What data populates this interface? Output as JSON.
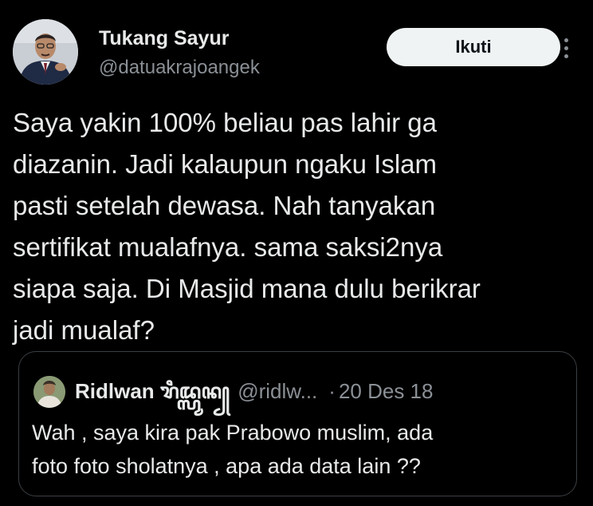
{
  "author": {
    "name": "Tukang Sayur",
    "handle": "@datuakrajoangek"
  },
  "follow_label": "Ikuti",
  "tweet_lines": [
    "Saya yakin 100% beliau pas lahir ga",
    "diazanin. Jadi kalaupun ngaku Islam",
    "pasti setelah dewasa. Nah tanyakan",
    "sertifikat mualafnya. sama saksi2nya",
    "siapa saja. Di Masjid mana dulu berikrar",
    "jadi mualaf?"
  ],
  "quote": {
    "name": "Ridlwan ꦫꦶꦢ꧀ꦭ꧀ꦮꦤ꧀",
    "handle": "@ridlw...",
    "separator": "·",
    "date": "20 Des 18",
    "lines": [
      "Wah , saya kira pak Prabowo muslim, ada",
      "foto foto sholatnya , apa ada data lain ??"
    ]
  },
  "colors": {
    "background": "#000000",
    "text_primary": "#e7e9ea",
    "text_secondary": "#8b9096",
    "follow_bg": "#eff3f4",
    "card_border": "#3a3f44"
  },
  "icons": {
    "more": "more-vertical-icon"
  }
}
